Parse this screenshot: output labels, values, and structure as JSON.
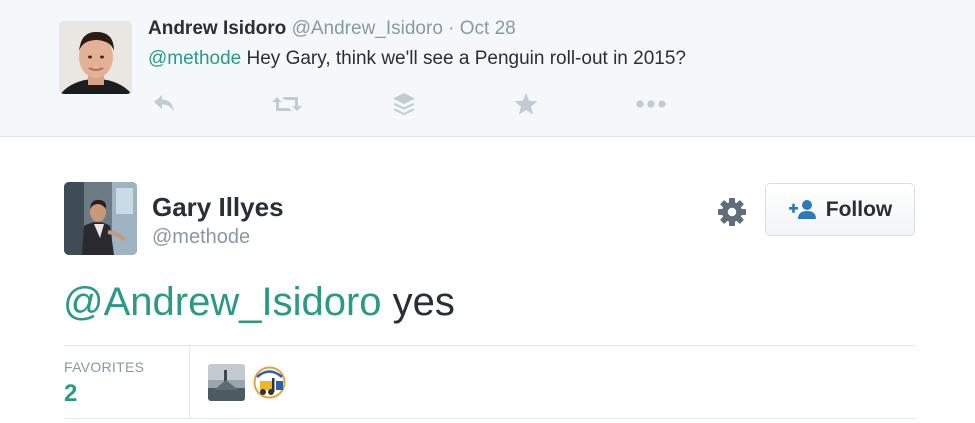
{
  "reply_tweet": {
    "name": "Andrew Isidoro",
    "handle": "@Andrew_Isidoro",
    "separator": "·",
    "date": "Oct 28",
    "mention": "@methode",
    "text": " Hey Gary, think we'll see a Penguin roll-out in 2015?",
    "actions": [
      "reply-icon",
      "retweet-icon",
      "buffer-icon",
      "favorite-icon",
      "more-icon"
    ]
  },
  "main_tweet": {
    "name": "Gary Illyes",
    "handle": "@methode",
    "mention": "@Andrew_Isidoro",
    "text": " yes",
    "follow_label": "Follow"
  },
  "stats": {
    "favorites_label": "FAVORITES",
    "favorites_count": "2"
  },
  "colors": {
    "link": "#2b9987",
    "muted": "#8899a6",
    "text": "#292f33",
    "reply_bg": "#f5f8fa",
    "follow_icon": "#2b7bb9"
  }
}
